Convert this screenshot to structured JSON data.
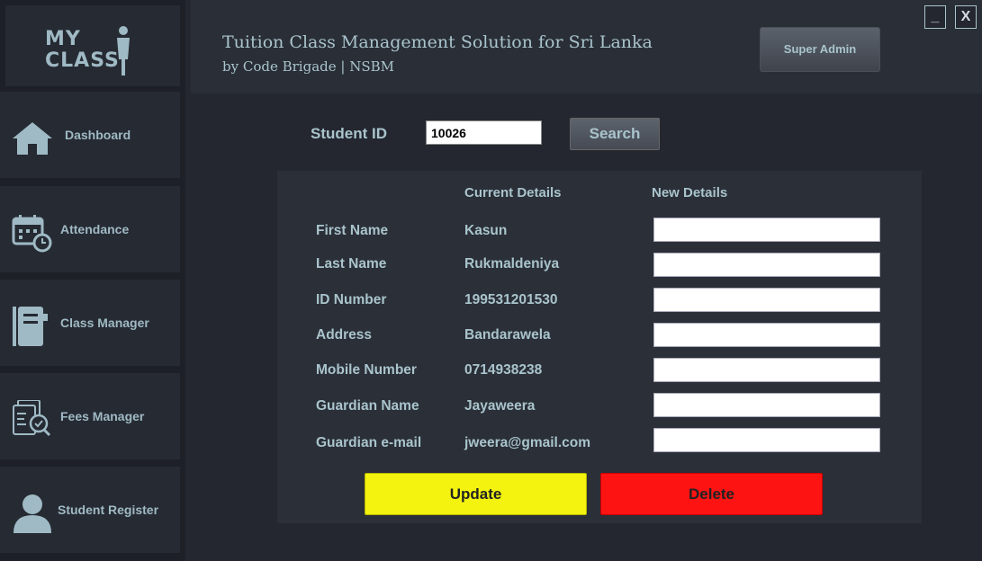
{
  "logo": {
    "line1": "MY",
    "line2": "CLASS"
  },
  "header": {
    "title": "Tuition Class Management Solution for Sri Lanka",
    "subtitle": "by Code Brigade | NSBM",
    "admin_label": "Super Admin",
    "minimize_label": "_",
    "close_label": "X"
  },
  "sidebar": {
    "items": [
      {
        "label": "Dashboard",
        "icon": "home-icon"
      },
      {
        "label": "Attendance",
        "icon": "calendar-clock-icon"
      },
      {
        "label": "Class Manager",
        "icon": "notebook-icon"
      },
      {
        "label": "Fees Manager",
        "icon": "document-check-icon"
      },
      {
        "label": "Student Register",
        "icon": "user-icon"
      }
    ]
  },
  "search": {
    "label": "Student ID",
    "value": "10026",
    "button_label": "Search"
  },
  "details": {
    "current_header": "Current Details",
    "new_header": "New Details",
    "rows": [
      {
        "label": "First Name",
        "value": "Kasun"
      },
      {
        "label": "Last Name",
        "value": "Rukmaldeniya"
      },
      {
        "label": "ID Number",
        "value": "199531201530"
      },
      {
        "label": "Address",
        "value": "Bandarawela"
      },
      {
        "label": "Mobile Number",
        "value": "0714938238"
      },
      {
        "label": "Guardian Name",
        "value": "Jayaweera"
      },
      {
        "label": "Guardian e-mail",
        "value": "jweera@gmail.com"
      }
    ]
  },
  "actions": {
    "update_label": "Update",
    "delete_label": "Delete"
  },
  "colors": {
    "background": "#242730",
    "text": "#a9c4cc",
    "update": "#f3f30f",
    "delete": "#fe1313"
  }
}
